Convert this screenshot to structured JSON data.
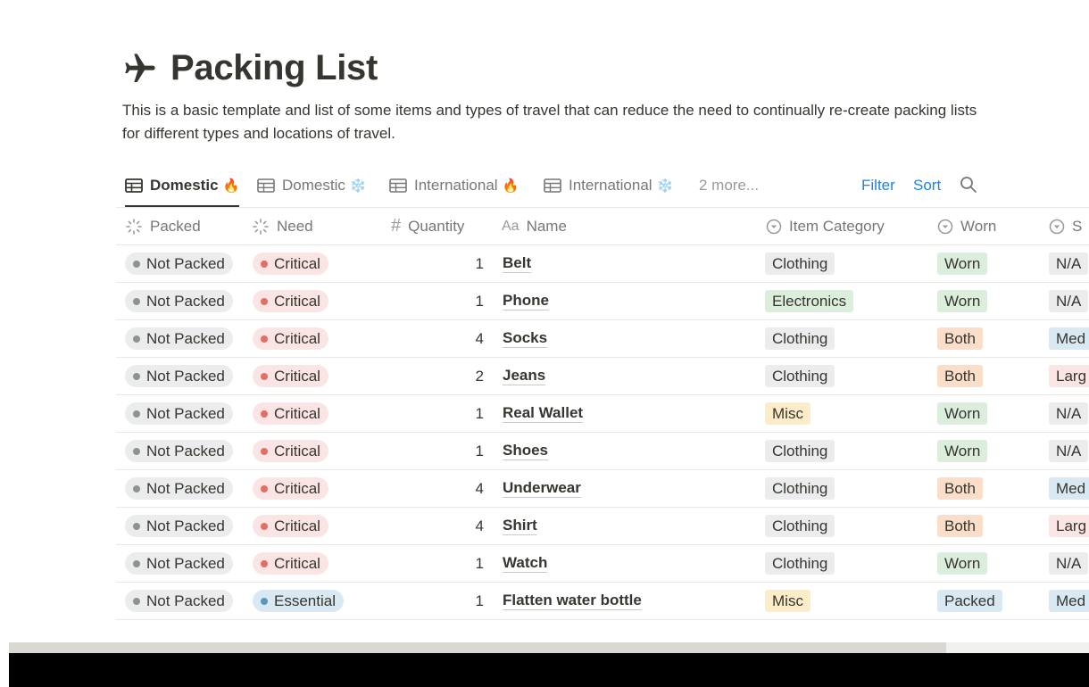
{
  "page": {
    "title": "Packing List",
    "title_icon": "airplane-icon",
    "description": "This is a basic template and list of some items and types of travel that can reduce the need to continually re-create packing lists for different types and locations of travel."
  },
  "views": {
    "tabs": [
      {
        "label": "Domestic",
        "emoji": "🔥",
        "active": true
      },
      {
        "label": "Domestic",
        "emoji": "❄️",
        "active": false
      },
      {
        "label": "International",
        "emoji": "🔥",
        "active": false
      },
      {
        "label": "International",
        "emoji": "❄️",
        "active": false
      }
    ],
    "more_label": "2 more...",
    "filter_label": "Filter",
    "sort_label": "Sort"
  },
  "table": {
    "columns": {
      "packed": "Packed",
      "need": "Need",
      "quantity": "Quantity",
      "name": "Name",
      "name_prefix": "Aa",
      "item_category": "Item Category",
      "worn": "Worn",
      "size": "S"
    },
    "rows": [
      {
        "packed": "Not Packed",
        "need": "Critical",
        "quantity": "1",
        "name": "Belt",
        "category": "Clothing",
        "worn": "Worn",
        "size": "N/A"
      },
      {
        "packed": "Not Packed",
        "need": "Critical",
        "quantity": "1",
        "name": "Phone",
        "category": "Electronics",
        "worn": "Worn",
        "size": "N/A"
      },
      {
        "packed": "Not Packed",
        "need": "Critical",
        "quantity": "4",
        "name": "Socks",
        "category": "Clothing",
        "worn": "Both",
        "size": "Med"
      },
      {
        "packed": "Not Packed",
        "need": "Critical",
        "quantity": "2",
        "name": "Jeans",
        "category": "Clothing",
        "worn": "Both",
        "size": "Larg"
      },
      {
        "packed": "Not Packed",
        "need": "Critical",
        "quantity": "1",
        "name": "Real Wallet",
        "category": "Misc",
        "worn": "Worn",
        "size": "N/A"
      },
      {
        "packed": "Not Packed",
        "need": "Critical",
        "quantity": "1",
        "name": "Shoes",
        "category": "Clothing",
        "worn": "Worn",
        "size": "N/A"
      },
      {
        "packed": "Not Packed",
        "need": "Critical",
        "quantity": "4",
        "name": "Underwear",
        "category": "Clothing",
        "worn": "Both",
        "size": "Med"
      },
      {
        "packed": "Not Packed",
        "need": "Critical",
        "quantity": "4",
        "name": "Shirt",
        "category": "Clothing",
        "worn": "Both",
        "size": "Larg"
      },
      {
        "packed": "Not Packed",
        "need": "Critical",
        "quantity": "1",
        "name": "Watch",
        "category": "Clothing",
        "worn": "Worn",
        "size": "N/A"
      },
      {
        "packed": "Not Packed",
        "need": "Essential",
        "quantity": "1",
        "name": "Flatten water bottle",
        "category": "Misc",
        "worn": "Packed",
        "size": "Med"
      }
    ]
  },
  "colors": {
    "text": "#37352f",
    "muted": "#787774",
    "accent_blue": "#2383e2",
    "gray_tag_bg": "#ebeced",
    "gray_dot": "#91918e",
    "red_tag_bg": "#fbe4e4",
    "red_dot": "#e16f64",
    "blue_tag_bg": "#d8e9f4",
    "blue_dot": "#5b97bd",
    "green_tag_bg": "#dbeddb",
    "orange_tag_bg": "#fadec9",
    "yellow_tag_bg": "#fdecc8"
  }
}
